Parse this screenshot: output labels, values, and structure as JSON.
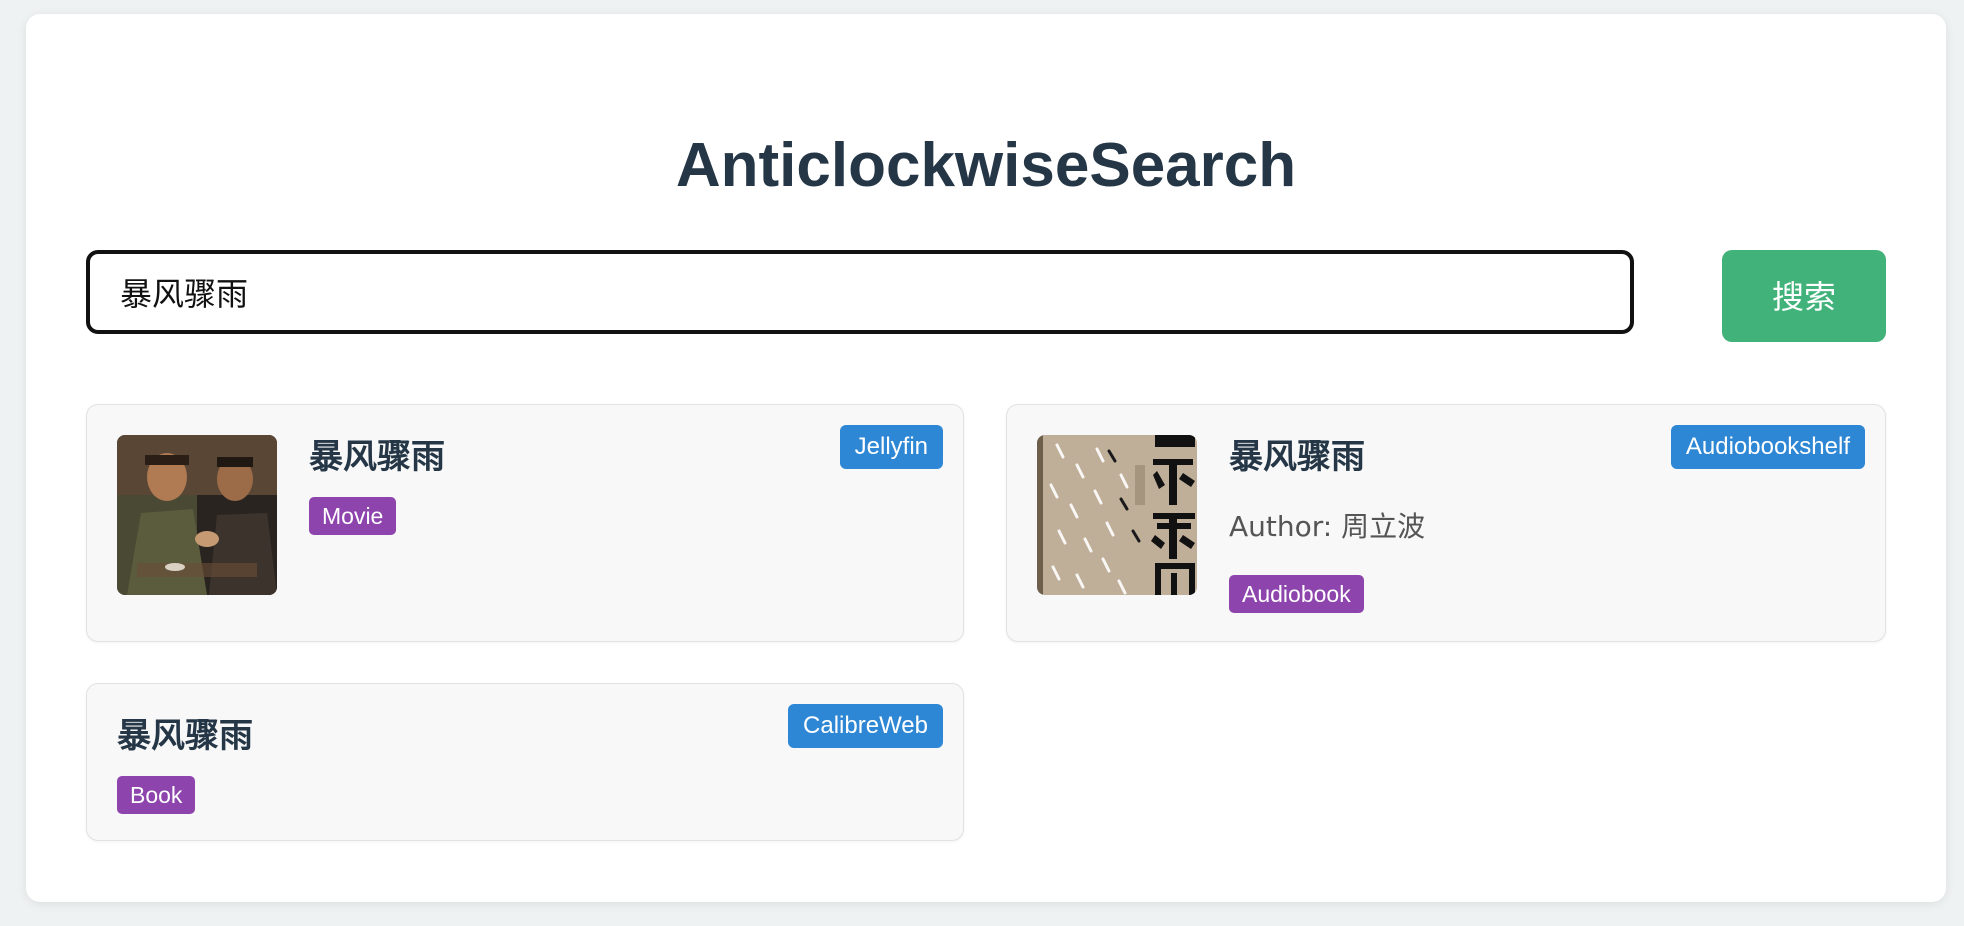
{
  "app": {
    "title": "AnticlockwiseSearch"
  },
  "search": {
    "value": "暴风骤雨",
    "placeholder": "",
    "button_label": "搜索"
  },
  "results": [
    {
      "title": "暴风骤雨",
      "type": "Movie",
      "source": "Jellyfin",
      "thumbnail": "movie-still-image"
    },
    {
      "title": "暴风骤雨",
      "author": "Author: 周立波",
      "type": "Audiobook",
      "source": "Audiobookshelf",
      "thumbnail": "book-cover-image"
    },
    {
      "title": "暴风骤雨",
      "type": "Book",
      "source": "CalibreWeb"
    }
  ],
  "colors": {
    "accent_green": "#41b37a",
    "source_badge_blue": "#2e87d4",
    "type_badge_purple": "#8e44ad",
    "title_text": "#253646"
  }
}
